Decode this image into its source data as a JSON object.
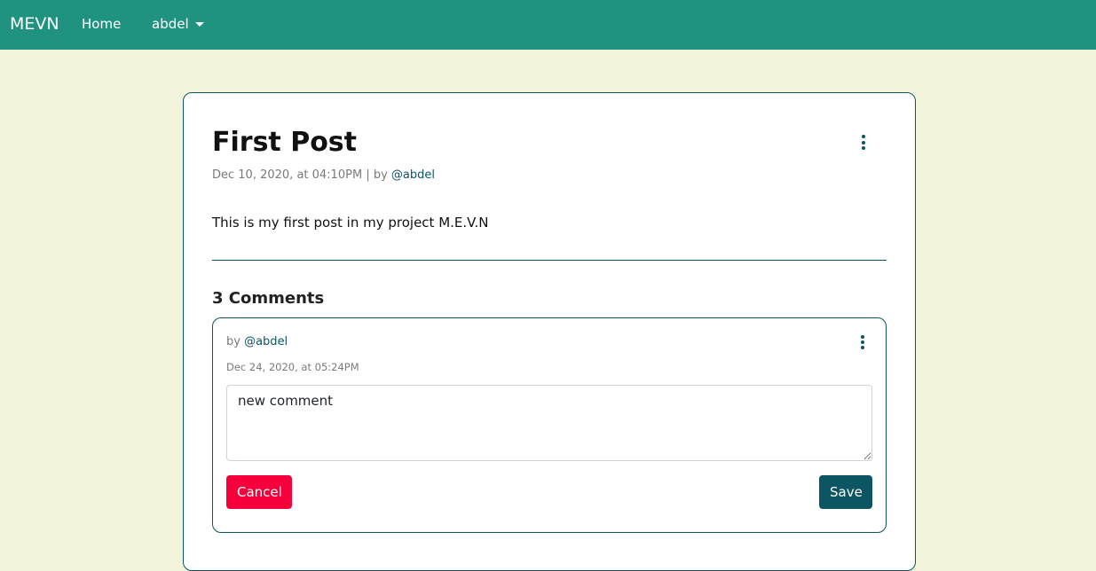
{
  "navbar": {
    "brand": "MEVN",
    "home_label": "Home",
    "user_menu_label": "abdel"
  },
  "post": {
    "title": "First Post",
    "date": "Dec 10, 2020, at 04:10PM",
    "by_prefix": "| by",
    "author": "@abdel",
    "body": "This is my first post in my project M.E.V.N"
  },
  "comments": {
    "heading": "3 Comments",
    "items": [
      {
        "by_prefix": "by",
        "author": "@abdel",
        "date": "Dec 24, 2020, at 05:24PM",
        "edit_value": "new comment",
        "cancel_label": "Cancel",
        "save_label": "Save"
      }
    ]
  },
  "colors": {
    "navbar": "#1f937f",
    "page_background": "#f2f5db",
    "accent": "#0c5562",
    "danger": "#f5003b"
  },
  "icons": {
    "post_menu": "kebab-vertical-icon",
    "comment_menu": "kebab-vertical-icon",
    "user_menu": "caret-down-icon"
  }
}
